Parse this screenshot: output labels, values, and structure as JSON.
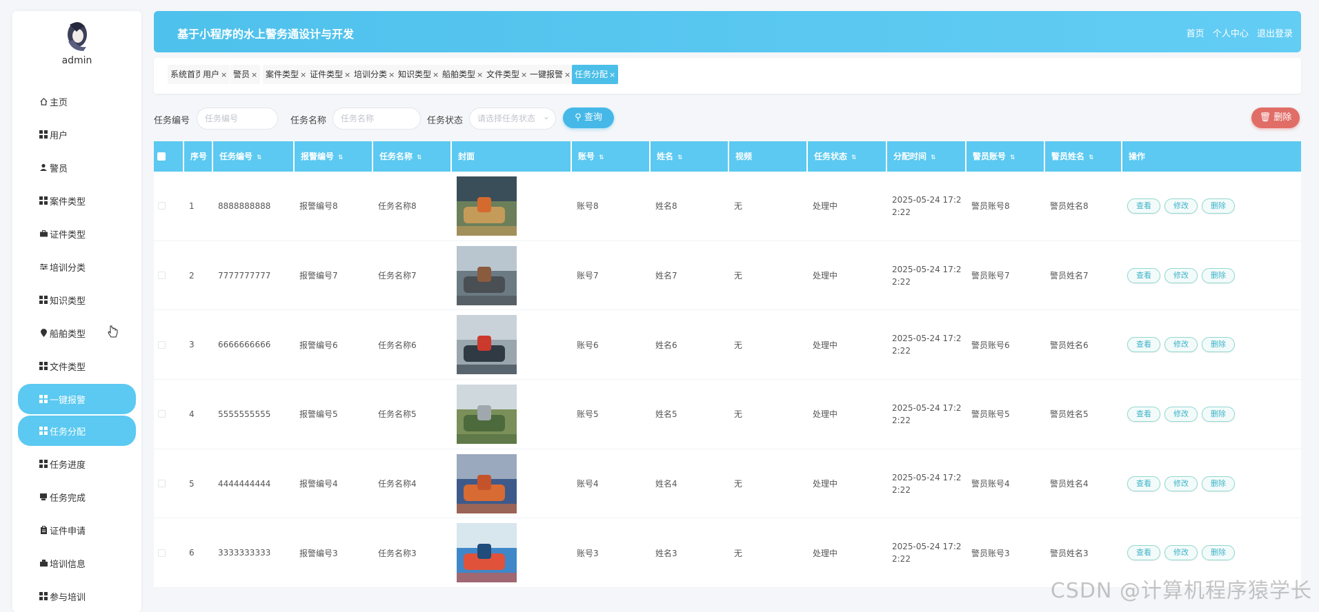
{
  "sidebar": {
    "admin_name": "admin",
    "items": [
      {
        "label": "主页",
        "icon": "home-icon"
      },
      {
        "label": "用户",
        "icon": "grid-icon"
      },
      {
        "label": "警员",
        "icon": "user-icon"
      },
      {
        "label": "案件类型",
        "icon": "grid-icon"
      },
      {
        "label": "证件类型",
        "icon": "briefcase-icon"
      },
      {
        "label": "培训分类",
        "icon": "sliders-icon"
      },
      {
        "label": "知识类型",
        "icon": "grid-icon"
      },
      {
        "label": "船舶类型",
        "icon": "location-icon"
      },
      {
        "label": "文件类型",
        "icon": "grid-icon"
      },
      {
        "label": "一键报警",
        "icon": "grid-icon"
      },
      {
        "label": "任务分配",
        "icon": "grid-icon"
      },
      {
        "label": "任务进度",
        "icon": "grid-icon"
      },
      {
        "label": "任务完成",
        "icon": "printer-icon"
      },
      {
        "label": "证件申请",
        "icon": "clipboard-icon"
      },
      {
        "label": "培训信息",
        "icon": "bookmark-icon"
      },
      {
        "label": "参与培训",
        "icon": "grid-icon"
      }
    ]
  },
  "header": {
    "title": "基于小程序的水上警务通设计与开发",
    "links": [
      "首页",
      "个人中心",
      "退出登录"
    ]
  },
  "tabs": [
    {
      "label": "系统首页",
      "closable": false
    },
    {
      "label": "用户",
      "closable": true
    },
    {
      "label": "警员",
      "closable": true
    },
    {
      "label": "案件类型",
      "closable": true
    },
    {
      "label": "证件类型",
      "closable": true
    },
    {
      "label": "培训分类",
      "closable": true
    },
    {
      "label": "知识类型",
      "closable": true
    },
    {
      "label": "船舶类型",
      "closable": true
    },
    {
      "label": "文件类型",
      "closable": true
    },
    {
      "label": "一键报警",
      "closable": true
    },
    {
      "label": "任务分配",
      "closable": true,
      "active": true
    }
  ],
  "tab_close": "×",
  "search": {
    "task_no_label": "任务编号",
    "task_no_placeholder": "任务编号",
    "task_name_label": "任务名称",
    "task_name_placeholder": "任务名称",
    "task_status_label": "任务状态",
    "task_status_placeholder": "请选择任务状态",
    "query_label": "查询",
    "delete_label": "删除"
  },
  "table": {
    "columns": [
      "序号",
      "任务编号",
      "报警编号",
      "任务名称",
      "封面",
      "账号",
      "姓名",
      "视频",
      "任务状态",
      "分配时间",
      "警员账号",
      "警员姓名",
      "操作"
    ],
    "sortable": [
      false,
      true,
      true,
      true,
      false,
      true,
      true,
      false,
      true,
      true,
      true,
      true,
      false
    ],
    "sort_icon": "⇅",
    "actions": [
      "查看",
      "修改",
      "删除"
    ],
    "rows": [
      {
        "idx": "1",
        "task_no": "8888888888",
        "alarm_no": "报警编号8",
        "task_name": "任务名称8",
        "account": "账号8",
        "name": "姓名8",
        "video": "无",
        "status": "处理中",
        "time": "2025-05-24 17:22:22",
        "officer_account": "警员账号8",
        "officer_name": "警员姓名8"
      },
      {
        "idx": "2",
        "task_no": "7777777777",
        "alarm_no": "报警编号7",
        "task_name": "任务名称7",
        "account": "账号7",
        "name": "姓名7",
        "video": "无",
        "status": "处理中",
        "time": "2025-05-24 17:22:22",
        "officer_account": "警员账号7",
        "officer_name": "警员姓名7"
      },
      {
        "idx": "3",
        "task_no": "6666666666",
        "alarm_no": "报警编号6",
        "task_name": "任务名称6",
        "account": "账号6",
        "name": "姓名6",
        "video": "无",
        "status": "处理中",
        "time": "2025-05-24 17:22:22",
        "officer_account": "警员账号6",
        "officer_name": "警员姓名6"
      },
      {
        "idx": "4",
        "task_no": "5555555555",
        "alarm_no": "报警编号5",
        "task_name": "任务名称5",
        "account": "账号5",
        "name": "姓名5",
        "video": "无",
        "status": "处理中",
        "time": "2025-05-24 17:22:22",
        "officer_account": "警员账号5",
        "officer_name": "警员姓名5"
      },
      {
        "idx": "5",
        "task_no": "4444444444",
        "alarm_no": "报警编号4",
        "task_name": "任务名称4",
        "account": "账号4",
        "name": "姓名4",
        "video": "无",
        "status": "处理中",
        "time": "2025-05-24 17:22:22",
        "officer_account": "警员账号4",
        "officer_name": "警员姓名4"
      },
      {
        "idx": "6",
        "task_no": "3333333333",
        "alarm_no": "报警编号3",
        "task_name": "任务名称3",
        "account": "账号3",
        "name": "姓名3",
        "video": "无",
        "status": "处理中",
        "time": "2025-05-24 17:22:22",
        "officer_account": "警员账号3",
        "officer_name": "警员姓名3"
      }
    ]
  },
  "watermark": "CSDN @计算机程序猿学长",
  "colors": {
    "accent": "#5bc9f1",
    "danger": "#e16d67",
    "query": "#45b8e8"
  }
}
